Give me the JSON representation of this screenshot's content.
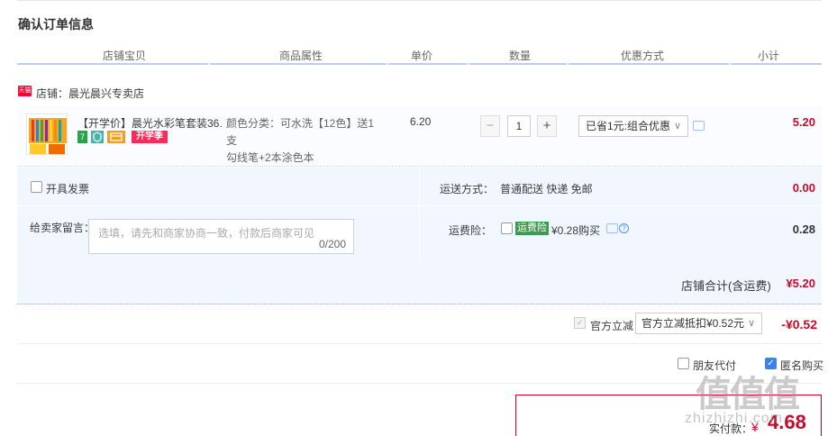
{
  "page": {
    "title": "确认订单信息"
  },
  "table_header": {
    "columns": [
      "店铺宝贝",
      "商品属性",
      "单价",
      "数量",
      "优惠方式",
      "小计"
    ]
  },
  "shop": {
    "icon_text": "天猫",
    "label": "店铺：晨光晨兴专卖店"
  },
  "item": {
    "title": "【开学价】晨光水彩笔套装36...",
    "badges": [
      {
        "icon": "seven-day-return-icon",
        "text": "7",
        "color": "#2ba245"
      },
      {
        "icon": "shield-icon",
        "text": "",
        "color": "#46b4a7"
      },
      {
        "icon": "card-icon",
        "text": "",
        "color": "#f0a020"
      },
      {
        "icon": "school-season-tag",
        "text": "开学季",
        "color": "#ff2a5a"
      }
    ],
    "attr_line1": "颜色分类：可水洗【12色】送1支",
    "attr_line2": "勾线笔+2本涂色本",
    "unit_price": "6.20",
    "quantity": "1",
    "qty_minus": "−",
    "qty_plus": "+",
    "promo": "已省1元:组合优惠",
    "subtotal": "5.20"
  },
  "invoice": {
    "label": "开具发票"
  },
  "delivery": {
    "label": "运送方式：",
    "value": "普通配送 快递 免邮",
    "fee": "0.00"
  },
  "memo": {
    "label": "给卖家留言：",
    "placeholder": "选填，请先和商家协商一致，付款后商家可见",
    "count": "0/200"
  },
  "insurance": {
    "label": "运费险：",
    "tag": "运费险",
    "text": "¥0.28购买",
    "price": "0.28"
  },
  "shop_total": {
    "label": "店铺合计(含运费)",
    "value": "¥5.20"
  },
  "discount": {
    "label": "官方立减",
    "select": "官方立减抵扣¥0.52元",
    "value": "-¥0.52"
  },
  "pay_options": {
    "friend": "朋友代付",
    "anonymous": "匿名购买"
  },
  "paid": {
    "label": "实付款：",
    "currency": "¥",
    "value": "4.68"
  },
  "watermark": {
    "big": "值值值",
    "small": "zhizhizhi.com"
  },
  "colors": {
    "price_red": "#c80a28",
    "accent_blue": "#3b82f0",
    "panel_bg": "#f2f7ff"
  }
}
